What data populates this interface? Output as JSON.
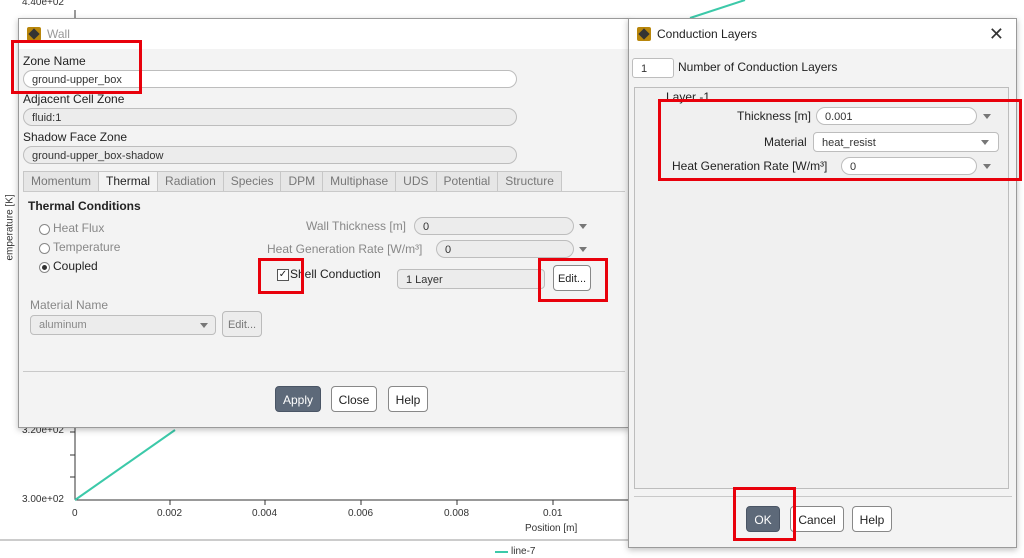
{
  "plot": {
    "y_top_label": "4.40e+02",
    "y_mid_label": "3.20e+02",
    "y_bottom_label": "3.00e+02",
    "y_axis_title": "emperature [K]",
    "x_ticks": [
      "0",
      "0.002",
      "0.004",
      "0.006",
      "0.008",
      "0.01"
    ],
    "x_axis_title": "Position [m]",
    "legend_entry": "line-7",
    "line_color": "#3cc9a9"
  },
  "wall_dialog": {
    "title": "Wall",
    "zone_name_label": "Zone Name",
    "zone_name_value": "ground-upper_box",
    "adjacent_label": "Adjacent Cell Zone",
    "adjacent_value": "fluid:1",
    "shadow_label": "Shadow Face Zone",
    "shadow_value": "ground-upper_box-shadow",
    "tabs": [
      "Momentum",
      "Thermal",
      "Radiation",
      "Species",
      "DPM",
      "Multiphase",
      "UDS",
      "Potential",
      "Structure"
    ],
    "active_tab": "Thermal",
    "thermal_conditions_label": "Thermal Conditions",
    "radio_heat_flux": "Heat Flux",
    "radio_temperature": "Temperature",
    "radio_coupled": "Coupled",
    "wall_thickness_label": "Wall Thickness [m]",
    "wall_thickness_value": "0",
    "heat_gen_label": "Heat Generation Rate [W/m³]",
    "heat_gen_value": "0",
    "shell_conduction_label": "Shell Conduction",
    "shell_layers_value": "1 Layer",
    "edit_label": "Edit...",
    "material_name_label": "Material Name",
    "material_value": "aluminum",
    "material_edit_label": "Edit...",
    "apply_label": "Apply",
    "close_label": "Close",
    "help_label": "Help"
  },
  "conduction_dialog": {
    "title": "Conduction Layers",
    "close_symbol": "✕",
    "num_layers_value": "1",
    "num_layers_label": "Number of Conduction Layers",
    "layer_group_label": "Layer -1",
    "thickness_label": "Thickness [m]",
    "thickness_value": "0.001",
    "material_label": "Material",
    "material_value": "heat_resist",
    "heat_gen_label": "Heat Generation Rate [W/m³]",
    "heat_gen_value": "0",
    "ok_label": "OK",
    "cancel_label": "Cancel",
    "help_label": "Help"
  },
  "highlight_color": "#e8000b"
}
